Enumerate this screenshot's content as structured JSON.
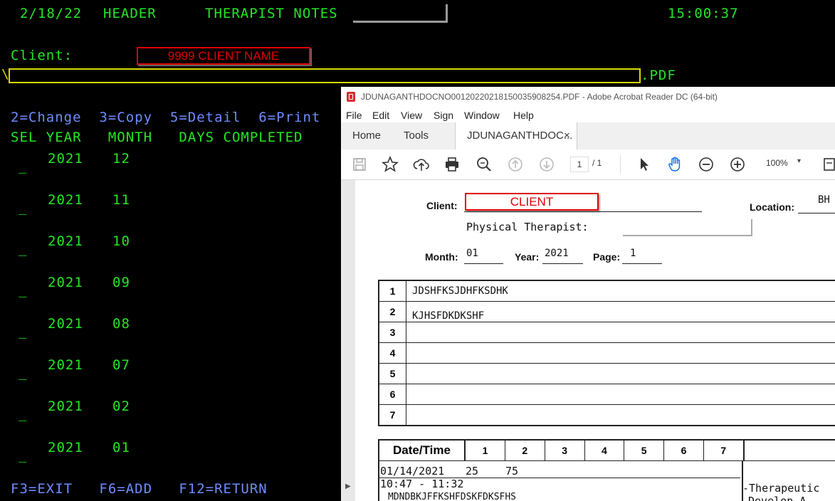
{
  "terminal": {
    "date": "2/18/22",
    "header": "HEADER",
    "title": "THERAPIST NOTES",
    "time": "15:00:37",
    "client_label": "Client:",
    "client_value": "9999   CLIENT NAME",
    "path_prefix": "\\",
    "path_suffix": ".PDF",
    "options": "2=Change  3=Copy  5=Detail  6=Print",
    "columns": "SEL YEAR   MONTH   DAYS COMPLETED",
    "rows": [
      {
        "sel": "_",
        "year": "2021",
        "month": "12"
      },
      {
        "sel": "_",
        "year": "2021",
        "month": "11"
      },
      {
        "sel": "_",
        "year": "2021",
        "month": "10"
      },
      {
        "sel": "_",
        "year": "2021",
        "month": "09"
      },
      {
        "sel": "_",
        "year": "2021",
        "month": "08"
      },
      {
        "sel": "_",
        "year": "2021",
        "month": "07"
      },
      {
        "sel": "_",
        "year": "2021",
        "month": "02"
      },
      {
        "sel": "_",
        "year": "2021",
        "month": "01"
      }
    ],
    "fkeys": "F3=EXIT   F6=ADD   F12=RETURN"
  },
  "acrobat": {
    "window_title": "JDUNAGANTHDOCNO001202202181500359082​54.PDF - Adobe Acrobat Reader DC (64-bit)",
    "menu": [
      "File",
      "Edit",
      "View",
      "Sign",
      "Window",
      "Help"
    ],
    "tabs": {
      "home": "Home",
      "tools": "Tools",
      "doc": "JDUNAGANTHDOC...",
      "close": "×"
    },
    "page_current": "1",
    "page_total": "/  1",
    "zoom": "100%",
    "doc": {
      "client_label": "Client:",
      "client_value": "CLIENT",
      "location_label": "Location:",
      "location_value": "BH",
      "therapist_label": "Physical Therapist:",
      "month_label": "Month:",
      "month_value": "01",
      "year_label": "Year:",
      "year_value": "2021",
      "page_label": "Page:",
      "page_value": "1",
      "note_rows": [
        {
          "n": "1",
          "text": "JDSHFKSJDHFKSDHK"
        },
        {
          "n": "2",
          "text": "KJHSFDKDKSHF"
        },
        {
          "n": "3",
          "text": ""
        },
        {
          "n": "4",
          "text": ""
        },
        {
          "n": "5",
          "text": ""
        },
        {
          "n": "6",
          "text": ""
        },
        {
          "n": "7",
          "text": ""
        }
      ],
      "dt_header": "Date/Time",
      "dt_cols": [
        "1",
        "2",
        "3",
        "4",
        "5",
        "6",
        "7"
      ],
      "dt_date": "01/14/2021",
      "dt_time": "10:47 - 11:32",
      "dt_v1": "25",
      "dt_v2": "75",
      "dt_cut": "MDNDBKJFFKSHFDSKFDKSFHS",
      "side_1": "-Therapeutic",
      "side_2": "Develop  A"
    }
  }
}
